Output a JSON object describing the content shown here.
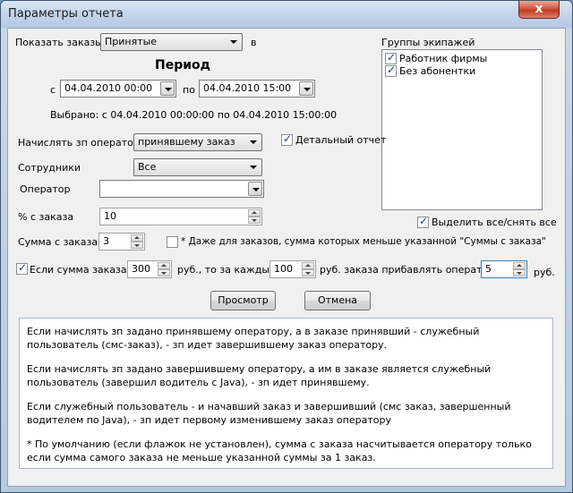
{
  "window": {
    "title": "Параметры отчета",
    "close_glyph": "x"
  },
  "show_orders": {
    "label": "Показать заказы",
    "value": "Принятые",
    "suffix": "в"
  },
  "period": {
    "title": "Период",
    "from_label": "с",
    "from_value": "04.04.2010 00:00",
    "to_label": "по",
    "to_value": "04.04.2010 15:00",
    "selected_text": "Выбрано: с 04.04.2010 00:00:00 по 04.04.2010 15:00:00"
  },
  "crew_groups": {
    "label": "Группы экипажей",
    "items": [
      {
        "label": "Работник фирмы",
        "checked": true
      },
      {
        "label": "Без абонентки",
        "checked": true
      }
    ],
    "select_all_label": "Выделить все/снять все"
  },
  "charge_operator": {
    "label": "Начислять зп оператору",
    "value": "принявшему заказ"
  },
  "detailed_report": {
    "label": "Детальный отчет",
    "checked": true
  },
  "employees": {
    "label": "Сотрудники",
    "value": "Все"
  },
  "operator": {
    "label": "Оператор",
    "value": ""
  },
  "percent": {
    "label": "% с заказа",
    "value": "10"
  },
  "order_sum": {
    "label": "Сумма с заказа",
    "value": "3",
    "even_less_label": "* Даже для заказов, сумма которых меньше указанной \"Суммы с заказа\"",
    "even_less_checked": false
  },
  "bonus": {
    "checked": true,
    "if_label": "Если сумма заказа >",
    "threshold": "300",
    "each_label": "руб., то за каждые",
    "step": "100",
    "add_label": "руб. заказа прибавлять оператору",
    "amount": "5",
    "unit": "руб."
  },
  "buttons": {
    "preview": "Просмотр",
    "cancel": "Отмена"
  },
  "info": {
    "paragraphs": [
      "Если начислять зп задано принявшему оператору, а в заказе принявший - служебный пользователь (смс-заказ), - зп идет завершившему заказ оператору.",
      "Если начислять зп задано завершившему оператору, а им в заказе является служебный пользователь (завершил водитель с Java), - зп идет принявшему.",
      "Если служебный пользователь - и начавший заказ и завершивший (смс заказ, завершенный водителем по Java), - зп идет первому изменившему заказ оператору",
      "* По умолчанию (если флажок не установлен), сумма с заказа насчитывается оператору только если сумма самого заказа не меньше указанной суммы за 1 заказ."
    ]
  }
}
